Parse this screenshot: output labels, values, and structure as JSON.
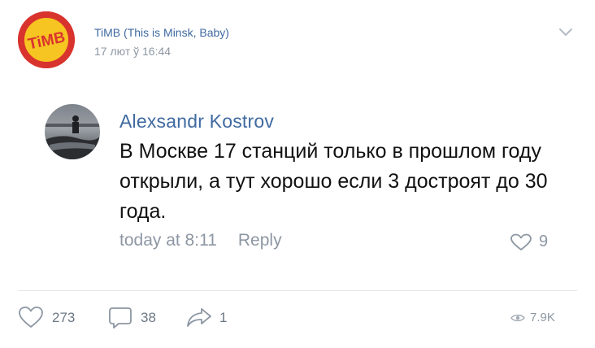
{
  "post": {
    "group_name": "TiMB (This is Minsk, Baby)",
    "time": "17 лют ў 16:44",
    "logo_text": "TiMB"
  },
  "comment": {
    "author": "Alexsandr Kostrov",
    "text": "В Москве 17 станций только в прошлом году открыли, а тут хорошо если 3 достроят до 30 года.",
    "time": "today at 8:11",
    "reply_label": "Reply",
    "likes": "9"
  },
  "actions": {
    "likes": "273",
    "comments": "38",
    "shares": "1",
    "views": "7.9K"
  },
  "colors": {
    "link": "#3f6aa0",
    "secondary": "#8d97a3",
    "logo_red": "#d9332e",
    "logo_yellow": "#f6c521"
  }
}
